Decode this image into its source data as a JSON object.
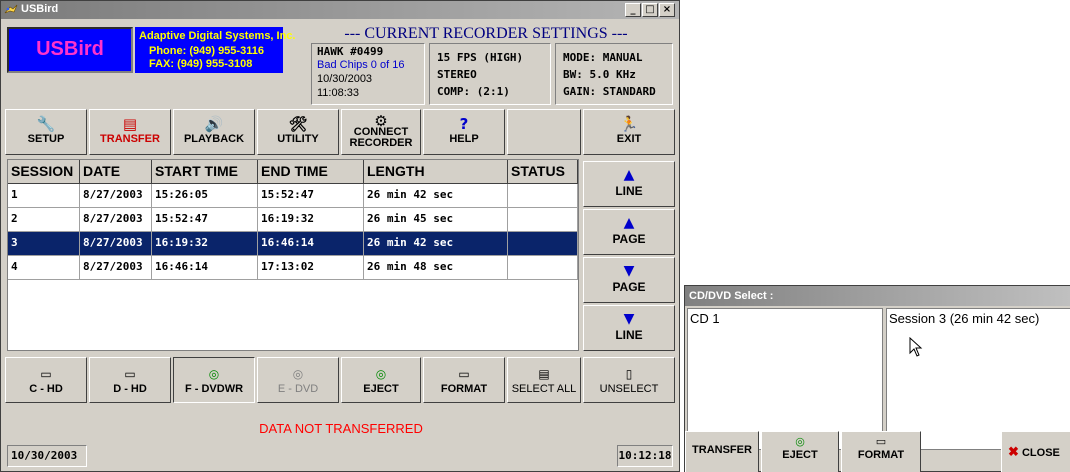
{
  "window": {
    "title": "USBird"
  },
  "header": {
    "logo_text": "USBird",
    "company_name": "Adaptive Digital Systems, Inc.",
    "phone": "Phone: (949) 955-3116",
    "fax": "FAX:    (949) 955-3108",
    "settings_title": "--- CURRENT RECORDER SETTINGS ---",
    "unit_name": "HAWK #0499",
    "bad_chips": "Bad Chips 0 of 16",
    "unit_date": "10/30/2003",
    "unit_time": "11:08:33",
    "rec_lines": [
      "15 FPS (HIGH)",
      "STEREO",
      "COMP: (2:1)"
    ],
    "mode_lines": [
      "MODE: MANUAL",
      "BW: 5.0 KHz",
      "GAIN: STANDARD"
    ]
  },
  "toolbar": {
    "setup": "SETUP",
    "transfer": "TRANSFER",
    "playback": "PLAYBACK",
    "utility": "UTILITY",
    "connect_1": "CONNECT",
    "connect_2": "RECORDER",
    "help": "HELP",
    "exit": "EXIT"
  },
  "table": {
    "columns": [
      "SESSION",
      "DATE",
      "START TIME",
      "END TIME",
      "LENGTH",
      "STATUS"
    ],
    "rows": [
      [
        "1",
        "8/27/2003",
        "15:26:05",
        "15:52:47",
        "26 min 42 sec",
        ""
      ],
      [
        "2",
        "8/27/2003",
        "15:52:47",
        "16:19:32",
        "26 min 45 sec",
        ""
      ],
      [
        "3",
        "8/27/2003",
        "16:19:32",
        "16:46:14",
        "26 min 42 sec",
        ""
      ],
      [
        "4",
        "8/27/2003",
        "16:46:14",
        "17:13:02",
        "26 min 48 sec",
        ""
      ]
    ],
    "selected_row": 3
  },
  "nav": {
    "line_up": "LINE",
    "page_up": "PAGE",
    "page_down": "PAGE",
    "line_down": "LINE"
  },
  "drives": {
    "c_hd": "C - HD",
    "d_hd": "D - HD",
    "f_dvdwr": "F - DVDWR",
    "e_dvd": "E - DVD",
    "eject": "EJECT",
    "format": "FORMAT",
    "select_all": "SELECT ALL",
    "unselect": "UNSELECT"
  },
  "status": {
    "message": "DATA NOT TRANSFERRED",
    "date": "10/30/2003",
    "time": "10:12:18"
  },
  "cd_dialog": {
    "title": "CD/DVD Select :",
    "disc_item": "CD 1",
    "session_item": "Session 3 (26 min 42 sec)",
    "transfer": "TRANSFER",
    "eject": "EJECT",
    "format": "FORMAT",
    "close": "CLOSE"
  },
  "colors": {
    "window_bg": "#d4d0c8",
    "selection": "#0a246a",
    "logo_bg": "#0000ff",
    "logo_text": "#ff33cc",
    "company_text": "#ffff00",
    "status_text": "#ff0000",
    "settings_title": "#000080"
  }
}
